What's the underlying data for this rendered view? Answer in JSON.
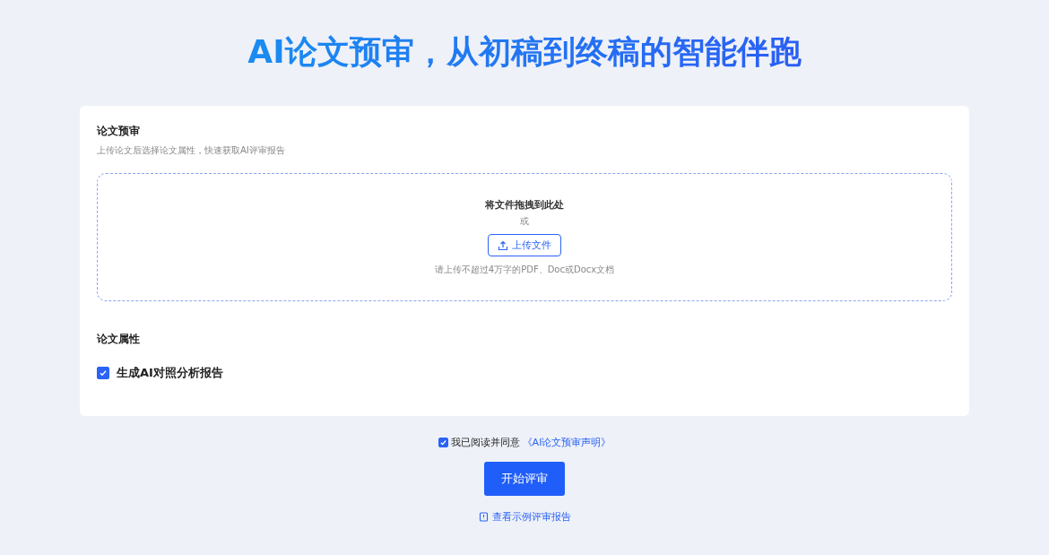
{
  "headline": "AI论文预审，从初稿到终稿的智能伴跑",
  "card": {
    "title": "论文预审",
    "subtitle": "上传论文后选择论文属性，快速获取AI评审报告",
    "upload": {
      "drop_text": "将文件拖拽到此处",
      "or_text": "或",
      "button": "上传文件",
      "hint": "请上传不超过4万字的PDF、Doc或Docx文档"
    },
    "attributes_title": "论文属性",
    "options": [
      {
        "label": "生成AI对照分析报告",
        "checked": true
      }
    ]
  },
  "agreement": {
    "checked": true,
    "text": "我已阅读并同意",
    "link": "《AI论文预审声明》"
  },
  "start_button": "开始评审",
  "sample_link": "查看示例评审报告"
}
